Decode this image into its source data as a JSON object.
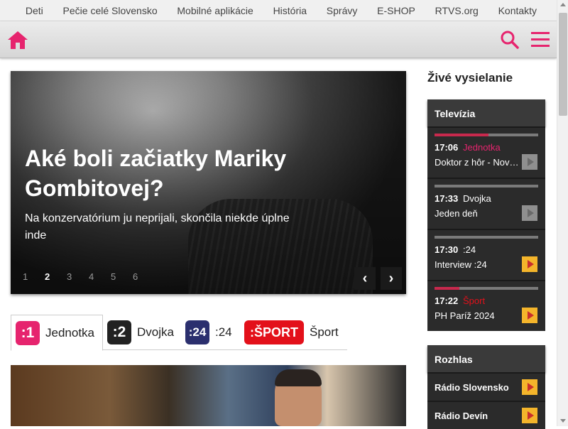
{
  "topnav": {
    "items": [
      "Deti",
      "Pečie celé Slovensko",
      "Mobilné aplikácie",
      "História",
      "Správy",
      "E-SHOP",
      "RTVS.org",
      "Kontakty"
    ]
  },
  "colors": {
    "brand": "#e6246e",
    "live_accent": "#c8294d",
    "play_live": "#f4b52b"
  },
  "header": {
    "icons": [
      "home-icon",
      "search-icon",
      "menu-icon"
    ]
  },
  "hero": {
    "title": "Aké boli začiatky Mariky Gombitovej?",
    "subtitle": "Na konzervatórium ju neprijali, skončila niekde úplne inde",
    "pages": [
      "1",
      "2",
      "3",
      "4",
      "5",
      "6"
    ],
    "active_page": "2",
    "prev_icon": "chevron-left-icon",
    "next_icon": "chevron-right-icon"
  },
  "channel_tabs": [
    {
      "logo": ":1",
      "label": "Jednotka",
      "logo_color": "#e6246e",
      "active": true
    },
    {
      "logo": ":2",
      "label": "Dvojka",
      "logo_color": "#222222",
      "active": false
    },
    {
      "logo": ":24",
      "label": ":24",
      "logo_color": "#2b2f6e",
      "active": false
    },
    {
      "logo": ":ŠPORT",
      "label": "Šport",
      "logo_color": "#e3101a",
      "active": false
    }
  ],
  "live": {
    "title": "Živé vysielanie",
    "tv": {
      "heading": "Televízia",
      "programs": [
        {
          "time": "17:06",
          "channel": "Jednotka",
          "channel_color": "#e6246e",
          "title": "Doktor z hôr - Nov…",
          "progress": 0.52,
          "play_active": false
        },
        {
          "time": "17:33",
          "channel": "Dvojka",
          "channel_color": "#ffffff",
          "title": "Jeden deň",
          "progress": 0.0,
          "play_active": false
        },
        {
          "time": "17:30",
          "channel": ":24",
          "channel_color": "#ffffff",
          "title": "Interview :24",
          "progress": 0.0,
          "play_active": true
        },
        {
          "time": "17:22",
          "channel": "Šport",
          "channel_color": "#e3101a",
          "title": "PH Paríž 2024",
          "progress": 0.24,
          "play_active": true
        }
      ]
    },
    "radio": {
      "heading": "Rozhlas",
      "stations": [
        "Rádio Slovensko",
        "Rádio Devín"
      ]
    }
  }
}
